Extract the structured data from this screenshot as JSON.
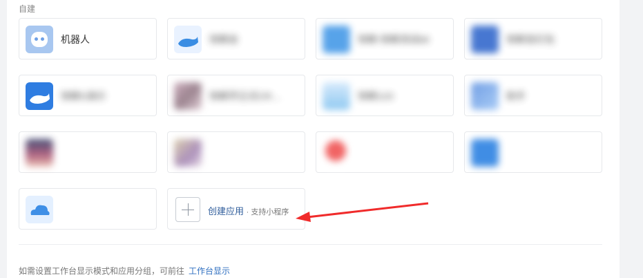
{
  "section": {
    "label": "自建"
  },
  "apps": [
    {
      "name": "机器人",
      "icon": "robot-icon"
    },
    {
      "name": "快鲸会",
      "icon": "whale-icon"
    },
    {
      "name": "快鲸-快鲸测试k6",
      "icon": "house-icon"
    },
    {
      "name": "快鲸发红包",
      "icon": "notice-icon"
    },
    {
      "name": "快鲸S演示",
      "icon": "whale-icon"
    },
    {
      "name": "快鲸学正式CR…",
      "icon": "app-icon"
    },
    {
      "name": "快鲸123",
      "icon": "app-icon"
    },
    {
      "name": "助手",
      "icon": "app-icon"
    },
    {
      "name": "",
      "icon": "photo-icon"
    },
    {
      "name": "",
      "icon": "app-icon"
    },
    {
      "name": "",
      "icon": "red-circle-icon"
    },
    {
      "name": "",
      "icon": "doc-icon"
    },
    {
      "name": "",
      "icon": "cloud-icon"
    }
  ],
  "create": {
    "title": "创建应用",
    "subtitle": "· 支持小程序"
  },
  "footer": {
    "text": "如需设置工作台显示模式和应用分组，可前往",
    "link": "工作台显示"
  },
  "colors": {
    "arrow": "#f02b2b",
    "link": "#2f6fc0"
  }
}
